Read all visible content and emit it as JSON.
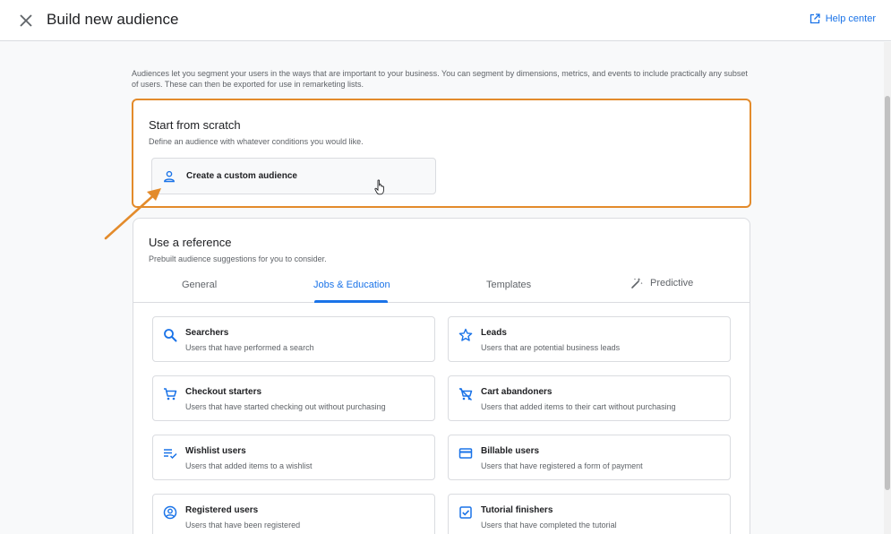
{
  "header": {
    "title": "Build new audience",
    "help_label": "Help center"
  },
  "intro_text": "Audiences let you segment your users in the ways that are important to your business. You can segment by dimensions, metrics, and events to include practically any subset of users. These can then be exported for use in remarketing lists.",
  "scratch": {
    "title": "Start from scratch",
    "subtitle": "Define an audience with whatever conditions you would like.",
    "button_label": "Create a custom audience"
  },
  "reference": {
    "title": "Use a reference",
    "subtitle": "Prebuilt audience suggestions for you to consider.",
    "tabs": [
      {
        "label": "General"
      },
      {
        "label": "Jobs & Education"
      },
      {
        "label": "Templates"
      },
      {
        "label": "Predictive"
      }
    ],
    "active_tab": "Jobs & Education",
    "options": [
      {
        "icon": "search-icon",
        "title": "Searchers",
        "description": "Users that have performed a search"
      },
      {
        "icon": "star-icon",
        "title": "Leads",
        "description": "Users that are potential business leads"
      },
      {
        "icon": "cart-icon",
        "title": "Checkout starters",
        "description": "Users that have started checking out without purchasing"
      },
      {
        "icon": "cart-off-icon",
        "title": "Cart abandoners",
        "description": "Users that added items to their cart without purchasing"
      },
      {
        "icon": "playlist-check-icon",
        "title": "Wishlist users",
        "description": "Users that added items to a wishlist"
      },
      {
        "icon": "credit-card-icon",
        "title": "Billable users",
        "description": "Users that have registered a form of payment"
      },
      {
        "icon": "account-circle-icon",
        "title": "Registered users",
        "description": "Users that have been registered"
      },
      {
        "icon": "checkbox-icon",
        "title": "Tutorial finishers",
        "description": "Users that have completed the tutorial"
      }
    ]
  },
  "colors": {
    "accent": "#1a73e8",
    "highlight": "#e38b2b"
  }
}
